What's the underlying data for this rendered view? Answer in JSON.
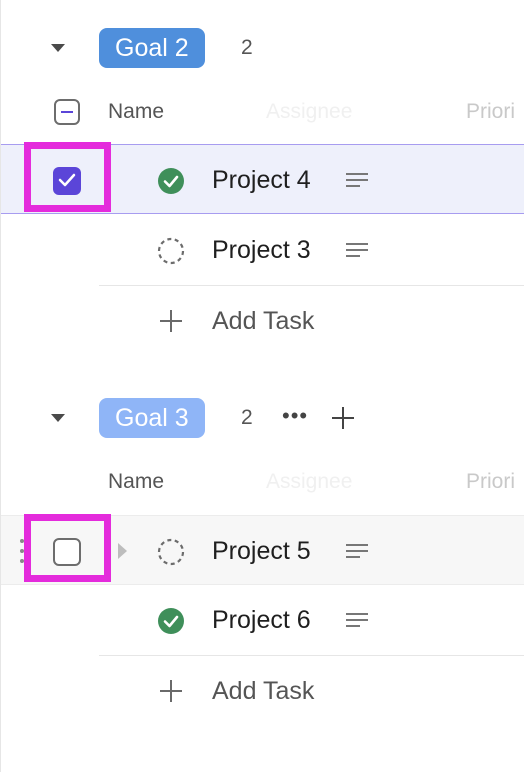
{
  "groups": [
    {
      "goal_label": "Goal 2",
      "goal_color": "#4f8fdc",
      "count": "2",
      "columns": {
        "name": "Name",
        "assignee": "Assignee",
        "priority": "Priori"
      },
      "tasks": [
        {
          "name": "Project 4",
          "status": "complete",
          "selected": true,
          "checked": true
        },
        {
          "name": "Project 3",
          "status": "incomplete",
          "selected": false,
          "checked": false
        }
      ],
      "add_task_label": "Add Task"
    },
    {
      "goal_label": "Goal 3",
      "goal_color": "#8fb5f7",
      "count": "2",
      "more_icon": "ellipsis-icon",
      "add_icon": "plus-icon",
      "columns": {
        "name": "Name",
        "assignee": "Assignee",
        "priority": "Priori"
      },
      "tasks": [
        {
          "name": "Project 5",
          "status": "incomplete",
          "selected": false,
          "checked": false
        },
        {
          "name": "Project 6",
          "status": "complete",
          "selected": false,
          "checked": false
        }
      ],
      "add_task_label": "Add Task"
    }
  ],
  "colors": {
    "accent": "#5b45d8",
    "complete_green": "#3f8f5a",
    "highlight": "#e42bdc"
  }
}
